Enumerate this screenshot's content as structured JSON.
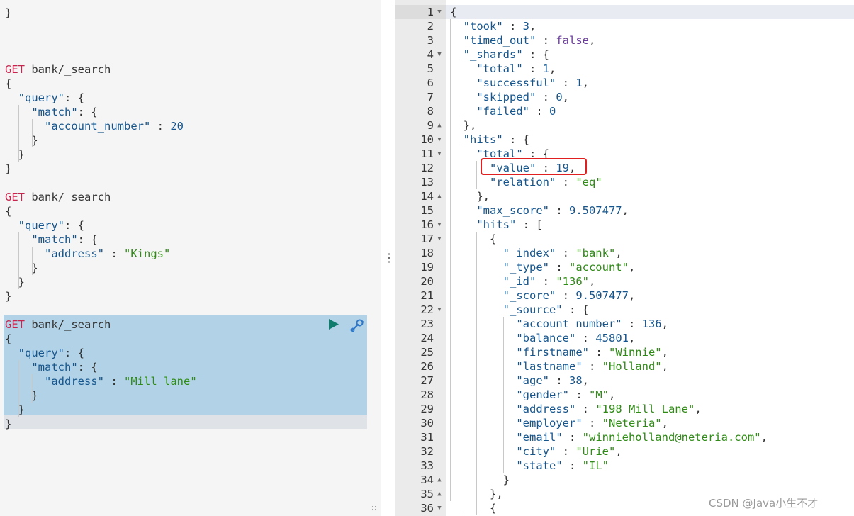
{
  "request_editor": {
    "lines": [
      {
        "t": "}"
      },
      {
        "t": "GET bank/_search"
      },
      {
        "t": "{"
      },
      {
        "t": "  \"query\": {"
      },
      {
        "t": "    \"match\": {"
      },
      {
        "t": "      \"account_number\" : 20"
      },
      {
        "t": "    }"
      },
      {
        "t": "  }"
      },
      {
        "t": "}"
      },
      {
        "t": "GET bank/_search"
      },
      {
        "t": "{"
      },
      {
        "t": "  \"query\": {"
      },
      {
        "t": "    \"match\": {"
      },
      {
        "t": "      \"address\" : \"Kings\""
      },
      {
        "t": "    }"
      },
      {
        "t": "  }"
      },
      {
        "t": "}"
      },
      {
        "t": "GET bank/_search"
      },
      {
        "t": "{"
      },
      {
        "t": "  \"query\": {"
      },
      {
        "t": "    \"match\": {"
      },
      {
        "t": "      \"address\" : \"Mill lane\""
      },
      {
        "t": "    }"
      },
      {
        "t": "  }"
      },
      {
        "t": "}"
      }
    ],
    "run_icon": "play-icon",
    "settings_icon": "wrench-icon"
  },
  "response_viewer": {
    "lines": [
      {
        "n": "1",
        "t": "{"
      },
      {
        "n": "2",
        "t": "  \"took\" : 3,"
      },
      {
        "n": "3",
        "t": "  \"timed_out\" : false,"
      },
      {
        "n": "4",
        "t": "  \"_shards\" : {"
      },
      {
        "n": "5",
        "t": "    \"total\" : 1,"
      },
      {
        "n": "6",
        "t": "    \"successful\" : 1,"
      },
      {
        "n": "7",
        "t": "    \"skipped\" : 0,"
      },
      {
        "n": "8",
        "t": "    \"failed\" : 0"
      },
      {
        "n": "9",
        "t": "  },"
      },
      {
        "n": "10",
        "t": "  \"hits\" : {"
      },
      {
        "n": "11",
        "t": "    \"total\" : {"
      },
      {
        "n": "12",
        "t": "      \"value\" : 19,"
      },
      {
        "n": "13",
        "t": "      \"relation\" : \"eq\""
      },
      {
        "n": "14",
        "t": "    },"
      },
      {
        "n": "15",
        "t": "    \"max_score\" : 9.507477,"
      },
      {
        "n": "16",
        "t": "    \"hits\" : ["
      },
      {
        "n": "17",
        "t": "      {"
      },
      {
        "n": "18",
        "t": "        \"_index\" : \"bank\","
      },
      {
        "n": "19",
        "t": "        \"_type\" : \"account\","
      },
      {
        "n": "20",
        "t": "        \"_id\" : \"136\","
      },
      {
        "n": "21",
        "t": "        \"_score\" : 9.507477,"
      },
      {
        "n": "22",
        "t": "        \"_source\" : {"
      },
      {
        "n": "23",
        "t": "          \"account_number\" : 136,"
      },
      {
        "n": "24",
        "t": "          \"balance\" : 45801,"
      },
      {
        "n": "25",
        "t": "          \"firstname\" : \"Winnie\","
      },
      {
        "n": "26",
        "t": "          \"lastname\" : \"Holland\","
      },
      {
        "n": "27",
        "t": "          \"age\" : 38,"
      },
      {
        "n": "28",
        "t": "          \"gender\" : \"M\","
      },
      {
        "n": "29",
        "t": "          \"address\" : \"198 Mill Lane\","
      },
      {
        "n": "30",
        "t": "          \"employer\" : \"Neteria\","
      },
      {
        "n": "31",
        "t": "          \"email\" : \"winnieholland@neteria.com\","
      },
      {
        "n": "32",
        "t": "          \"city\" : \"Urie\","
      },
      {
        "n": "33",
        "t": "          \"state\" : \"IL\""
      },
      {
        "n": "34",
        "t": "        }"
      },
      {
        "n": "35",
        "t": "      },"
      },
      {
        "n": "36",
        "t": "      {"
      }
    ],
    "highlighted_line": "12"
  },
  "colors": {
    "selection": "#b2d3e7",
    "highlight_box": "#e02020",
    "method": "#c7254e",
    "key": "#16558c",
    "string": "#2f8a16"
  },
  "watermark": "CSDN @Java小生不才"
}
